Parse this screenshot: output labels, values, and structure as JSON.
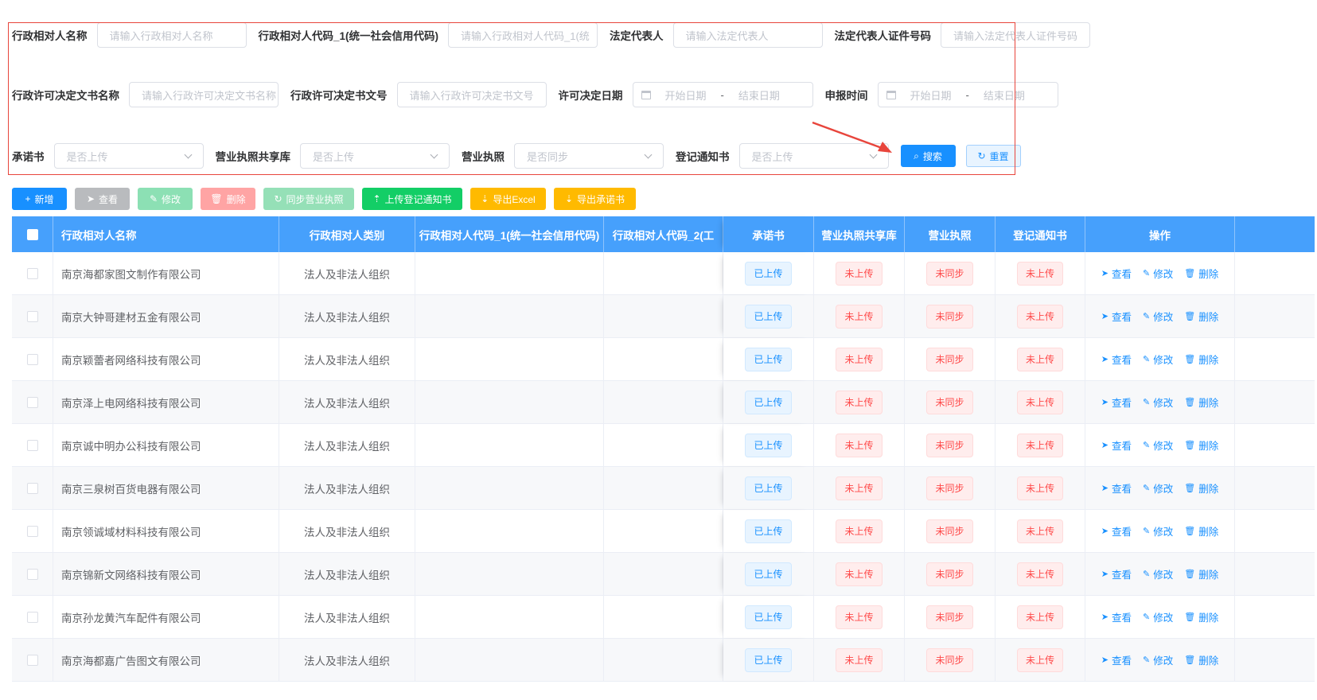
{
  "search": {
    "row1": [
      {
        "label": "行政相对人名称",
        "placeholder": "请输入行政相对人名称"
      },
      {
        "label": "行政相对人代码_1(统一社会信用代码)",
        "placeholder": "请输入行政相对人代码_1(统"
      },
      {
        "label": "法定代表人",
        "placeholder": "请输入法定代表人"
      },
      {
        "label": "法定代表人证件号码",
        "placeholder": "请输入法定代表人证件号码"
      }
    ],
    "row2": {
      "doc_name_label": "行政许可决定文书名称",
      "doc_name_placeholder": "请输入行政许可决定文书名称",
      "doc_no_label": "行政许可决定书文号",
      "doc_no_placeholder": "请输入行政许可决定书文号",
      "permit_date_label": "许可决定日期",
      "apply_time_label": "申报时间",
      "start_date": "开始日期",
      "range_sep": "-",
      "end_date": "结束日期"
    },
    "row3": [
      {
        "label": "承诺书",
        "placeholder": "是否上传"
      },
      {
        "label": "营业执照共享库",
        "placeholder": "是否上传"
      },
      {
        "label": "营业执照",
        "placeholder": "是否同步"
      },
      {
        "label": "登记通知书",
        "placeholder": "是否上传"
      }
    ],
    "search_button": "搜索",
    "reset_button": "重置"
  },
  "toolbar": [
    {
      "label": "新增",
      "icon": "+",
      "color": "#1890ff"
    },
    {
      "label": "查看",
      "icon": "➤",
      "color": "#b9bbbe"
    },
    {
      "label": "修改",
      "icon": "✎",
      "color": "#8ce0b4"
    },
    {
      "label": "删除",
      "icon": "🗑",
      "color": "#ffa4a4"
    },
    {
      "label": "同步营业执照",
      "icon": "↻",
      "color": "#95e0b7"
    },
    {
      "label": "上传登记通知书",
      "icon": "⇡",
      "color": "#13ce66"
    },
    {
      "label": "导出Excel",
      "icon": "⇣",
      "color": "#ffba00"
    },
    {
      "label": "导出承诺书",
      "icon": "⇣",
      "color": "#ffba00"
    }
  ],
  "table": {
    "headers": [
      "行政相对人名称",
      "行政相对人类别",
      "行政相对人代码_1(统一社会信用代码)",
      "行政相对人代码_2(工",
      "承诺书",
      "营业执照共享库",
      "营业执照",
      "登记通知书",
      "操作"
    ],
    "ops": {
      "view": "查看",
      "edit": "修改",
      "delete": "删除"
    },
    "rows": [
      {
        "name": "南京海都家图文制作有限公司",
        "category": "法人及非法人组织",
        "code1": "",
        "code2": "",
        "commit": "已上传",
        "share": "未上传",
        "license": "未同步",
        "notice": "未上传"
      },
      {
        "name": "南京大钟哥建材五金有限公司",
        "category": "法人及非法人组织",
        "code1": "",
        "code2": "",
        "commit": "已上传",
        "share": "未上传",
        "license": "未同步",
        "notice": "未上传"
      },
      {
        "name": "南京颖蕾者网络科技有限公司",
        "category": "法人及非法人组织",
        "code1": "",
        "code2": "",
        "commit": "已上传",
        "share": "未上传",
        "license": "未同步",
        "notice": "未上传"
      },
      {
        "name": "南京泽上电网络科技有限公司",
        "category": "法人及非法人组织",
        "code1": "",
        "code2": "",
        "commit": "已上传",
        "share": "未上传",
        "license": "未同步",
        "notice": "未上传"
      },
      {
        "name": "南京诚中明办公科技有限公司",
        "category": "法人及非法人组织",
        "code1": "",
        "code2": "",
        "commit": "已上传",
        "share": "未上传",
        "license": "未同步",
        "notice": "未上传"
      },
      {
        "name": "南京三泉树百货电器有限公司",
        "category": "法人及非法人组织",
        "code1": "",
        "code2": "",
        "commit": "已上传",
        "share": "未上传",
        "license": "未同步",
        "notice": "未上传"
      },
      {
        "name": "南京领诚域材料科技有限公司",
        "category": "法人及非法人组织",
        "code1": "",
        "code2": "",
        "commit": "已上传",
        "share": "未上传",
        "license": "未同步",
        "notice": "未上传"
      },
      {
        "name": "南京锦新文网络科技有限公司",
        "category": "法人及非法人组织",
        "code1": "",
        "code2": "",
        "commit": "已上传",
        "share": "未上传",
        "license": "未同步",
        "notice": "未上传"
      },
      {
        "name": "南京孙龙黄汽车配件有限公司",
        "category": "法人及非法人组织",
        "code1": "",
        "code2": "",
        "commit": "已上传",
        "share": "未上传",
        "license": "未同步",
        "notice": "未上传"
      },
      {
        "name": "南京海都嘉广告图文有限公司",
        "category": "法人及非法人组织",
        "code1": "",
        "code2": "",
        "commit": "已上传",
        "share": "未上传",
        "license": "未同步",
        "notice": "未上传"
      }
    ]
  }
}
